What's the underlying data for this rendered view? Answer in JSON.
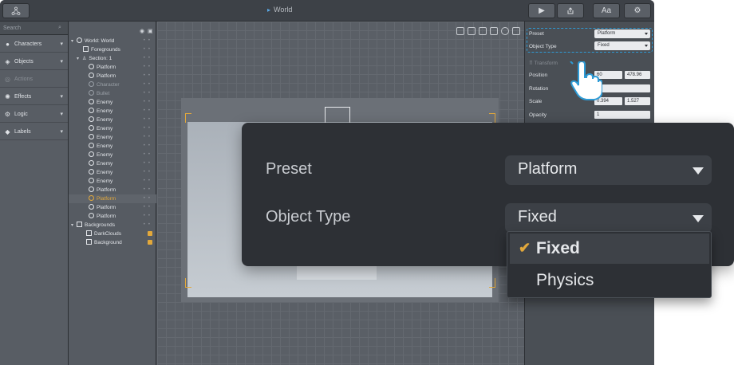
{
  "window": {
    "title": "World"
  },
  "toolbar": {
    "play_icon": "play-icon",
    "export_icon": "export-icon",
    "text_label": "Aa",
    "settings_icon": "gear-icon"
  },
  "sidebar": {
    "search_placeholder": "Search",
    "items": [
      {
        "label": "Characters",
        "icon": "person-icon"
      },
      {
        "label": "Objects",
        "icon": "cube-icon"
      },
      {
        "label": "Actions",
        "icon": "actions-icon",
        "disabled": true
      },
      {
        "label": "Effects",
        "icon": "effects-icon"
      },
      {
        "label": "Logic",
        "icon": "logic-icon"
      },
      {
        "label": "Labels",
        "icon": "tag-icon"
      }
    ]
  },
  "tree": {
    "rows": [
      {
        "label": "World: World"
      },
      {
        "label": "Foregrounds"
      },
      {
        "label": "Section: 1"
      },
      {
        "label": "Platform"
      },
      {
        "label": "Platform"
      },
      {
        "label": "Character"
      },
      {
        "label": "Bullet"
      },
      {
        "label": "Enemy"
      },
      {
        "label": "Enemy"
      },
      {
        "label": "Enemy"
      },
      {
        "label": "Enemy"
      },
      {
        "label": "Enemy"
      },
      {
        "label": "Enemy"
      },
      {
        "label": "Enemy"
      },
      {
        "label": "Enemy"
      },
      {
        "label": "Enemy"
      },
      {
        "label": "Enemy"
      },
      {
        "label": "Platform"
      },
      {
        "label": "Platform"
      },
      {
        "label": "Platform"
      },
      {
        "label": "Platform"
      },
      {
        "label": "Platform"
      },
      {
        "label": "Backgrounds"
      },
      {
        "label": "DarkClouds"
      },
      {
        "label": "Background"
      }
    ]
  },
  "props": {
    "preset_label": "Preset",
    "preset_value": "Platform",
    "object_type_label": "Object Type",
    "object_type_value": "Fixed",
    "transform_label": "Transform",
    "position_label": "Position",
    "position_x": "60",
    "position_y": "478.96",
    "rotation_label": "Rotation",
    "rotation_value": "0",
    "scale_label": "Scale",
    "scale_x": "0.394",
    "scale_y": "1.527",
    "opacity_label": "Opacity",
    "opacity_value": "1"
  },
  "zoom": {
    "preset_label": "Preset",
    "preset_value": "Platform",
    "object_type_label": "Object Type",
    "object_type_value": "Fixed",
    "options": [
      "Fixed",
      "Physics"
    ],
    "selected_option": "Fixed"
  },
  "colors": {
    "accent": "#e2a83b",
    "highlight_blue": "#2e9bd6"
  }
}
